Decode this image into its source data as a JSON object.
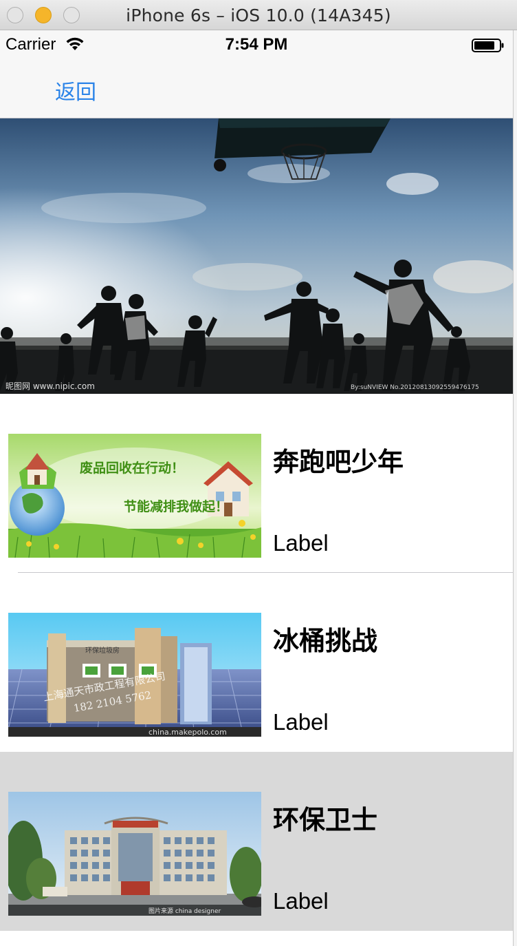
{
  "window": {
    "title": "iPhone 6s – iOS 10.0 (14A345)"
  },
  "status_bar": {
    "carrier": "Carrier",
    "time": "7:54 PM",
    "icons": [
      "wifi-icon",
      "battery-icon"
    ]
  },
  "nav": {
    "back_label": "返回",
    "tint_color": "#2a83e8"
  },
  "hero": {
    "image": "basketball-silhouette-photo",
    "watermark_left": "昵图网 www.nipic.com",
    "watermark_right": "By:suNVIEW No.20120813092559476175"
  },
  "cells": [
    {
      "title": "奔跑吧少年",
      "subtitle": "Label",
      "image": "recycling-banner-photo",
      "image_text_1": "废品回收在行动！",
      "image_text_2": "节能减排我做起！",
      "selected": false
    },
    {
      "title": "冰桶挑战",
      "subtitle": "Label",
      "image": "kiosk-building-photo",
      "image_text_1": "上海通天市政工程有限公司",
      "image_text_2": "182 2104 5762",
      "image_text_3": "china.makepolo.com",
      "selected": false
    },
    {
      "title": "环保卫士",
      "subtitle": "Label",
      "image": "office-building-photo",
      "image_text_1": "图片来源 china designer",
      "selected": true
    }
  ]
}
